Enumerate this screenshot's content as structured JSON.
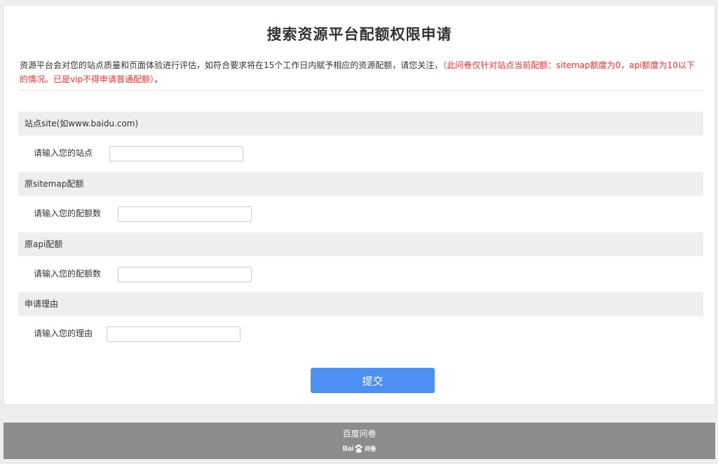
{
  "page": {
    "title": "搜索资源平台配额权限申请",
    "description_normal": "资源平台会对您的站点质量和页面体验进行评估，如符合要求将在15个工作日内赋予相应的资源配额，请您关注，",
    "description_red": "（此问卷仅针对站点当前配额：sitemap额度为0，api额度为10以下的情况。已是vip不得申请普通配额）",
    "description_end": "。"
  },
  "form": {
    "sections": [
      {
        "header": "站点site(如www.baidu.com)",
        "label": "请输入您的站点",
        "value": ""
      },
      {
        "header": "原sitemap配额",
        "label": "请输入您的配额数",
        "value": ""
      },
      {
        "header": "原api配额",
        "label": "请输入您的配额数",
        "value": ""
      },
      {
        "header": "申请理由",
        "label": "请输入您的理由",
        "value": ""
      }
    ],
    "submit_label": "提交"
  },
  "footer": {
    "text": "百度问卷",
    "logo_left": "Bai",
    "logo_right": "问卷"
  },
  "colors": {
    "accent": "#4e8ff4",
    "warning_red": "#ff2d2d",
    "footer_bg": "#8c8c8c",
    "section_bg": "#eeeeee"
  }
}
